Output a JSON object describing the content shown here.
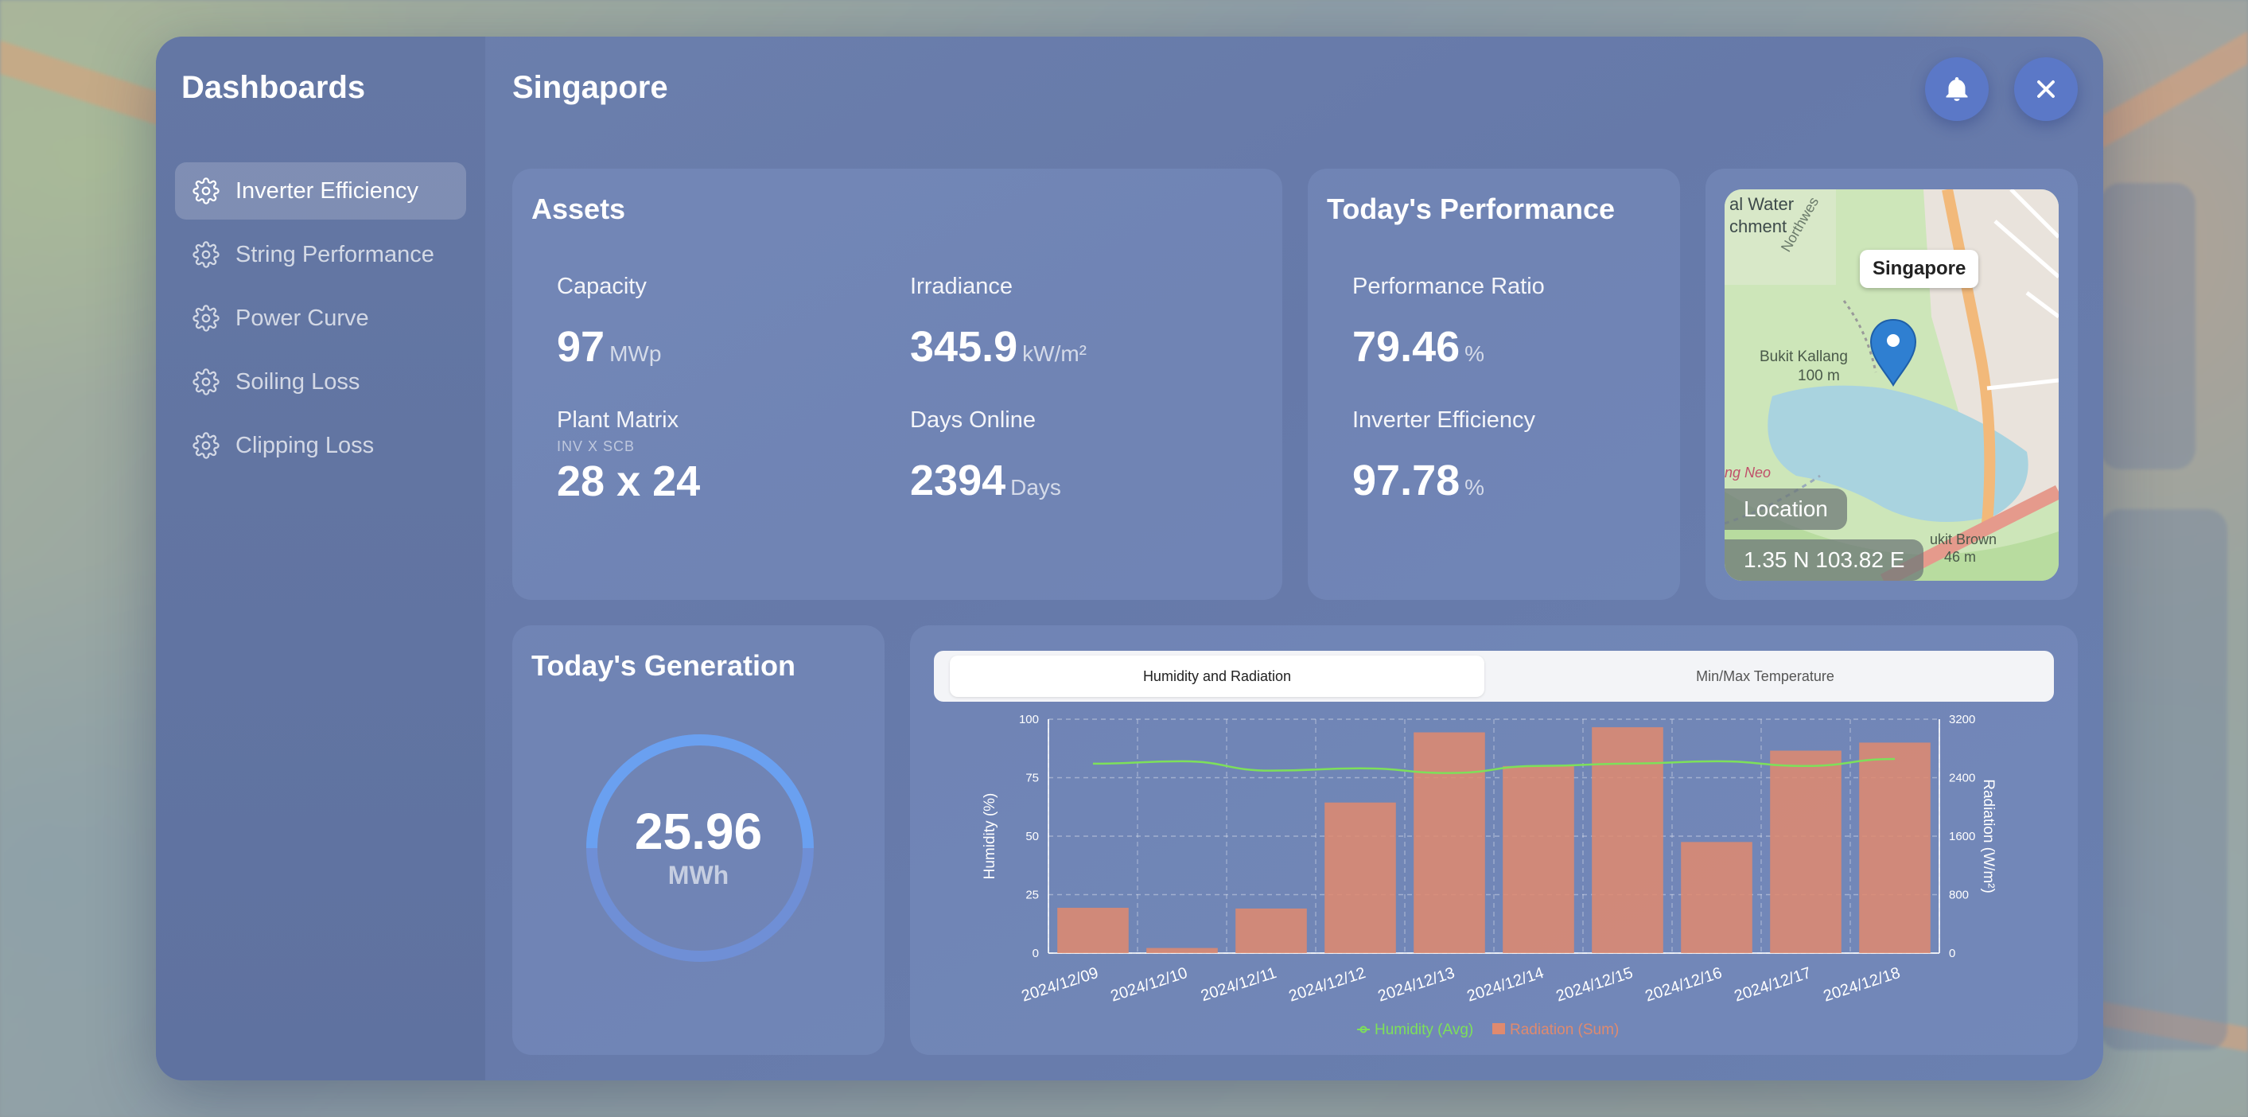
{
  "sidebar": {
    "title": "Dashboards",
    "items": [
      {
        "label": "Inverter Efficiency",
        "active": true
      },
      {
        "label": "String Performance",
        "active": false
      },
      {
        "label": "Power Curve",
        "active": false
      },
      {
        "label": "Soiling Loss",
        "active": false
      },
      {
        "label": "Clipping Loss",
        "active": false
      }
    ]
  },
  "header": {
    "title": "Singapore",
    "bell_icon": "bell-icon",
    "close_icon": "close-icon",
    "button_color": "#5b78c7"
  },
  "assets": {
    "title": "Assets",
    "capacity": {
      "label": "Capacity",
      "value": "97",
      "unit": "MWp"
    },
    "irradiance": {
      "label": "Irradiance",
      "value": "345.9",
      "unit": "kW/m²"
    },
    "plant_matrix": {
      "label": "Plant Matrix",
      "sub": "INV X SCB",
      "value": "28 x 24"
    },
    "days_online": {
      "label": "Days Online",
      "value": "2394",
      "unit": "Days"
    }
  },
  "performance": {
    "title": "Today's Performance",
    "performance_ratio": {
      "label": "Performance Ratio",
      "value": "79.46",
      "unit": "%"
    },
    "inverter_efficiency": {
      "label": "Inverter Efficiency",
      "value": "97.78",
      "unit": "%"
    }
  },
  "map": {
    "marker_label": "Singapore",
    "location_label": "Location",
    "coordinates": "1.35 N 103.82 E",
    "labels": [
      "al Water",
      "chment",
      "Bukit Kallang",
      "100 m",
      "Northwes",
      "ng Neo",
      "ukit Brown",
      "46 m"
    ]
  },
  "generation": {
    "title": "Today's Generation",
    "value": "25.96",
    "unit": "MWh",
    "ring_color": "#6aa0f0"
  },
  "chart_tabs": [
    {
      "label": "Humidity and Radiation",
      "active": true
    },
    {
      "label": "Min/Max Temperature",
      "active": false
    }
  ],
  "chart_data": {
    "type": "bar",
    "categories": [
      "2024/12/09",
      "2024/12/10",
      "2024/12/11",
      "2024/12/12",
      "2024/12/13",
      "2024/12/14",
      "2024/12/15",
      "2024/12/16",
      "2024/12/17",
      "2024/12/18"
    ],
    "series": [
      {
        "name": "Humidity (Avg)",
        "type": "line",
        "axis": "left",
        "color": "#7de05a",
        "values": [
          81,
          82,
          78,
          79,
          77,
          80,
          81,
          82,
          80,
          83
        ]
      },
      {
        "name": "Radiation (Sum)",
        "type": "bar",
        "axis": "right",
        "color": "#e08a6e",
        "values": [
          620,
          70,
          610,
          2060,
          3020,
          2560,
          3090,
          1520,
          2770,
          2880
        ]
      }
    ],
    "ylabel": "Humidity (%)",
    "y2label": "Radiation (W/m²)",
    "ylim": [
      0,
      100
    ],
    "y2lim": [
      0,
      3200
    ],
    "yticks": [
      "0",
      "25",
      "50",
      "75",
      "100"
    ],
    "y2ticks": [
      "0",
      "800",
      "1600",
      "2400",
      "3200"
    ],
    "grid": true,
    "legend": "bottom"
  }
}
